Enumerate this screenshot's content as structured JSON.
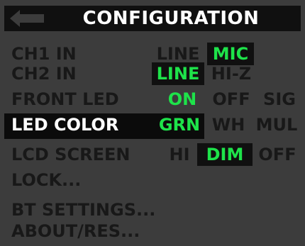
{
  "title": "CONFIGURATION",
  "colors": {
    "accent": "#1ee34a",
    "background": "#3c3c3c",
    "text": "#181818"
  },
  "menu": [
    {
      "label": "CH1 IN",
      "options": [
        "LINE",
        "MIC"
      ],
      "selected": "MIC"
    },
    {
      "label": "CH2 IN",
      "options": [
        "LINE",
        "HI-Z"
      ],
      "selected": "LINE"
    },
    {
      "label": "FRONT LED",
      "options": [
        "ON",
        "OFF",
        "SIG"
      ],
      "selected": "ON"
    },
    {
      "label": "LED COLOR",
      "options": [
        "GRN",
        "WH",
        "MUL"
      ],
      "selected": "GRN",
      "focused": true
    },
    {
      "label": "LCD SCREEN",
      "options": [
        "HI",
        "DIM",
        "OFF"
      ],
      "selected": "DIM"
    },
    {
      "label": "LOCK..."
    },
    {
      "label": "BT SETTINGS..."
    },
    {
      "label": "ABOUT/RES..."
    }
  ]
}
